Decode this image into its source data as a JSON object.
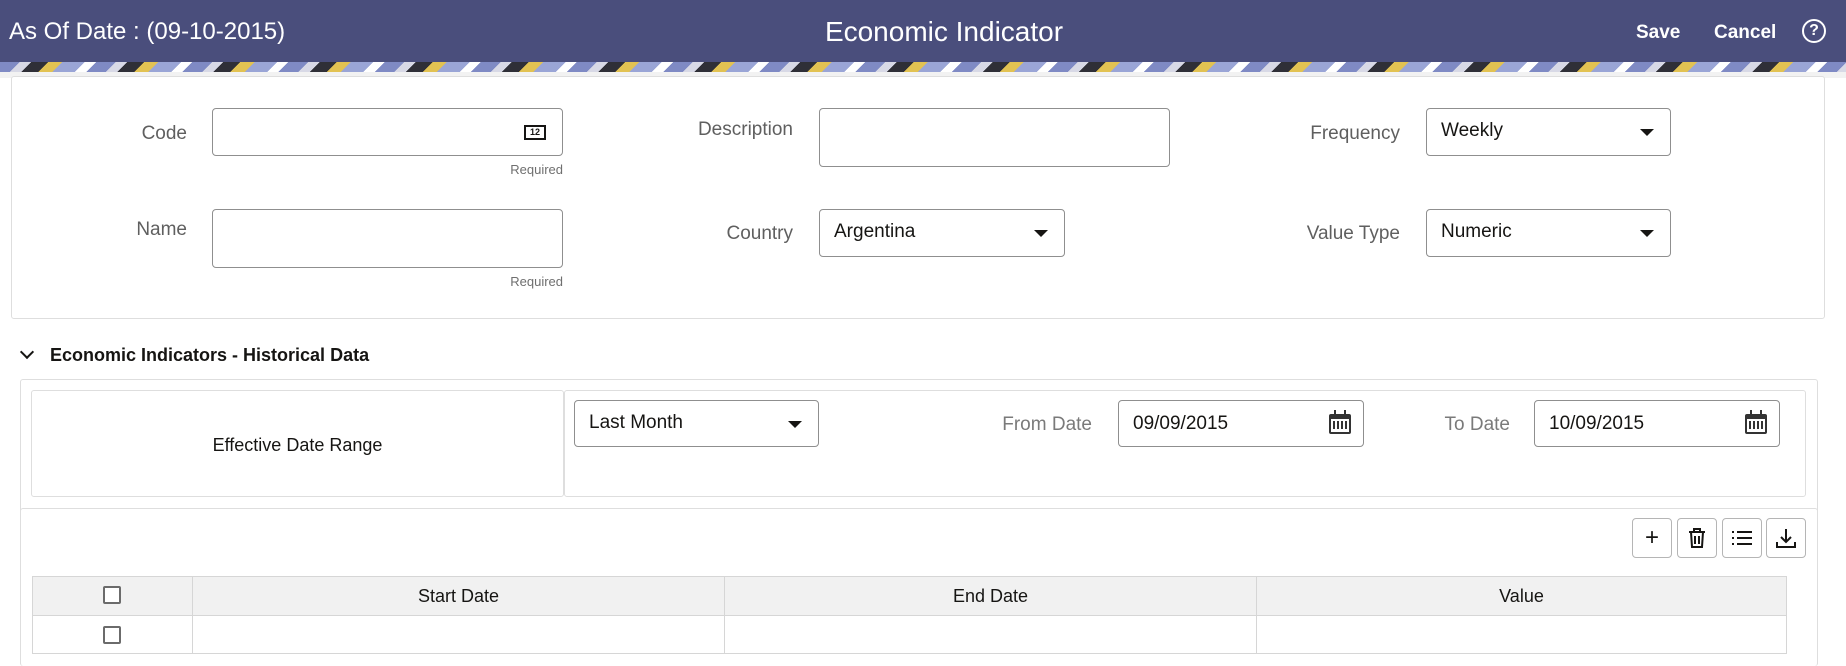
{
  "header": {
    "as_of": "As Of Date : (09-10-2015)",
    "title": "Economic Indicator",
    "save_label": "Save",
    "cancel_label": "Cancel",
    "help_glyph": "?"
  },
  "form": {
    "code": {
      "label": "Code",
      "value": "",
      "hint": "Required",
      "icon_text": "12"
    },
    "name": {
      "label": "Name",
      "value": "",
      "hint": "Required"
    },
    "description": {
      "label": "Description",
      "value": ""
    },
    "country": {
      "label": "Country",
      "value": "Argentina"
    },
    "frequency": {
      "label": "Frequency",
      "value": "Weekly"
    },
    "value_type": {
      "label": "Value Type",
      "value": "Numeric"
    }
  },
  "historical": {
    "title": "Economic Indicators - Historical Data",
    "range_label": "Effective Date Range",
    "range_value": "Last Month",
    "from_label": "From Date",
    "from_value": "09/09/2015",
    "to_label": "To Date",
    "to_value": "10/09/2015"
  },
  "toolbar": {
    "add_glyph": "+",
    "icons": [
      "plus-icon",
      "trash-icon",
      "list-icon",
      "download-icon"
    ]
  },
  "table": {
    "columns": [
      "Start Date",
      "End Date",
      "Value"
    ],
    "rows": [
      [
        "",
        "",
        ""
      ]
    ]
  },
  "colors": {
    "header_bg": "#4a4e7c",
    "border": "#8f8f8f"
  }
}
